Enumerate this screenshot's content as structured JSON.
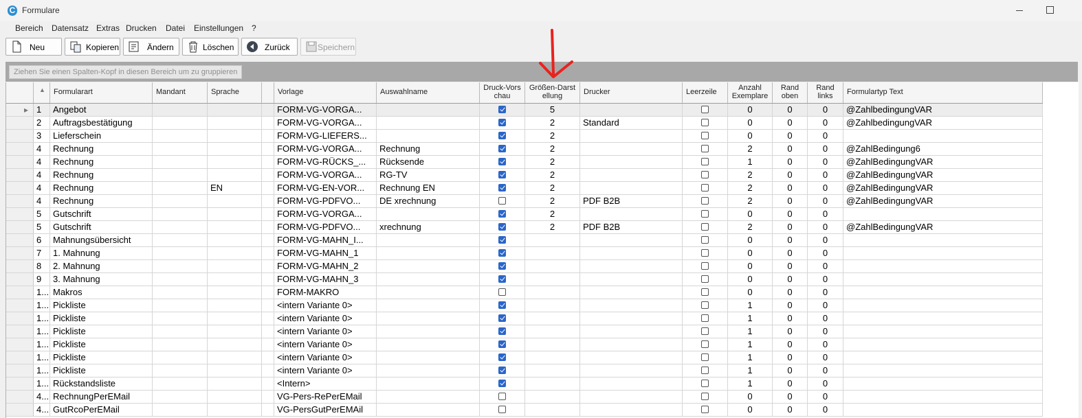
{
  "window": {
    "title": "Formulare"
  },
  "menu": [
    "Bereich",
    "Datensatz",
    "Extras",
    "Drucken",
    "Datei",
    "Einstellungen",
    "?"
  ],
  "toolbar": {
    "new_label": "Neu",
    "copy_label": "Kopieren",
    "edit_label": "Ändern",
    "delete_label": "Löschen",
    "back_label": "Zurück",
    "save_label": "Speichern"
  },
  "group_hint": "Ziehen Sie einen Spalten-Kopf in diesen Bereich um zu gruppieren",
  "columns": [
    "Formularart",
    "Mandant",
    "Sprache",
    "",
    "Vorlage",
    "Auswahlname",
    "Druck-Vorschau",
    "Größen-Darstellung",
    "Drucker",
    "Leerzeile",
    "Anzahl Exemplare",
    "Rand oben",
    "Rand links",
    "Formulartyp Text"
  ],
  "column_headers": {
    "formularart": "Formularart",
    "mandant": "Mandant",
    "sprache": "Sprache",
    "blank": "",
    "vorlage": "Vorlage",
    "auswahlname": "Auswahlname",
    "druckvorschau": "Druck-Vors chau",
    "groessen": "Größen-Darst ellung",
    "drucker": "Drucker",
    "leerzeile": "Leerzeile",
    "anzahl": "Anzahl Exemplare",
    "rand_oben": "Rand oben",
    "rand_links": "Rand links",
    "formulartyp": "Formulartyp Text"
  },
  "rows": [
    {
      "nr": "1",
      "formularart": "Angebot",
      "mandant": "",
      "sprache": "",
      "vorlage": "FORM-VG-VORGA...",
      "auswahlname": "",
      "druckvorschau": true,
      "groessen": "5",
      "drucker": "",
      "leerzeile": false,
      "anzahl": "0",
      "rand_oben": "0",
      "rand_links": "0",
      "formulartyp": "@ZahlbedingungVAR"
    },
    {
      "nr": "2",
      "formularart": "Auftragsbestätigung",
      "mandant": "",
      "sprache": "",
      "vorlage": "FORM-VG-VORGA...",
      "auswahlname": "",
      "druckvorschau": true,
      "groessen": "2",
      "drucker": "Standard",
      "leerzeile": false,
      "anzahl": "0",
      "rand_oben": "0",
      "rand_links": "0",
      "formulartyp": "@ZahlbedingungVAR"
    },
    {
      "nr": "3",
      "formularart": "Lieferschein",
      "mandant": "",
      "sprache": "",
      "vorlage": "FORM-VG-LIEFERS...",
      "auswahlname": "",
      "druckvorschau": true,
      "groessen": "2",
      "drucker": "",
      "leerzeile": false,
      "anzahl": "0",
      "rand_oben": "0",
      "rand_links": "0",
      "formulartyp": ""
    },
    {
      "nr": "4",
      "formularart": "Rechnung",
      "mandant": "",
      "sprache": "",
      "vorlage": "FORM-VG-VORGA...",
      "auswahlname": "Rechnung",
      "druckvorschau": true,
      "groessen": "2",
      "drucker": "",
      "leerzeile": false,
      "anzahl": "2",
      "rand_oben": "0",
      "rand_links": "0",
      "formulartyp": "@ZahlBedingung6"
    },
    {
      "nr": "4",
      "formularart": "Rechnung",
      "mandant": "",
      "sprache": "",
      "vorlage": "FORM-VG-RÜCKS_...",
      "auswahlname": "Rücksende",
      "druckvorschau": true,
      "groessen": "2",
      "drucker": "",
      "leerzeile": false,
      "anzahl": "1",
      "rand_oben": "0",
      "rand_links": "0",
      "formulartyp": "@ZahlBedingungVAR"
    },
    {
      "nr": "4",
      "formularart": "Rechnung",
      "mandant": "",
      "sprache": "",
      "vorlage": "FORM-VG-VORGA...",
      "auswahlname": "RG-TV",
      "druckvorschau": true,
      "groessen": "2",
      "drucker": "",
      "leerzeile": false,
      "anzahl": "2",
      "rand_oben": "0",
      "rand_links": "0",
      "formulartyp": "@ZahlBedingungVAR"
    },
    {
      "nr": "4",
      "formularart": "Rechnung",
      "mandant": "",
      "sprache": "EN",
      "vorlage": "FORM-VG-EN-VOR...",
      "auswahlname": "Rechnung EN",
      "druckvorschau": true,
      "groessen": "2",
      "drucker": "",
      "leerzeile": false,
      "anzahl": "2",
      "rand_oben": "0",
      "rand_links": "0",
      "formulartyp": "@ZahlBedingungVAR"
    },
    {
      "nr": "4",
      "formularart": "Rechnung",
      "mandant": "",
      "sprache": "",
      "vorlage": "FORM-VG-PDFVO...",
      "auswahlname": "DE xrechnung",
      "druckvorschau": false,
      "groessen": "2",
      "drucker": "PDF B2B",
      "leerzeile": false,
      "anzahl": "2",
      "rand_oben": "0",
      "rand_links": "0",
      "formulartyp": "@ZahlBedingungVAR"
    },
    {
      "nr": "5",
      "formularart": "Gutschrift",
      "mandant": "",
      "sprache": "",
      "vorlage": "FORM-VG-VORGA...",
      "auswahlname": "",
      "druckvorschau": true,
      "groessen": "2",
      "drucker": "",
      "leerzeile": false,
      "anzahl": "0",
      "rand_oben": "0",
      "rand_links": "0",
      "formulartyp": ""
    },
    {
      "nr": "5",
      "formularart": "Gutschrift",
      "mandant": "",
      "sprache": "",
      "vorlage": "FORM-VG-PDFVO...",
      "auswahlname": "xrechnung",
      "druckvorschau": true,
      "groessen": "2",
      "drucker": "PDF B2B",
      "leerzeile": false,
      "anzahl": "2",
      "rand_oben": "0",
      "rand_links": "0",
      "formulartyp": "@ZahlBedingungVAR"
    },
    {
      "nr": "6",
      "formularart": "Mahnungsübersicht",
      "mandant": "",
      "sprache": "",
      "vorlage": "FORM-VG-MAHN_I...",
      "auswahlname": "",
      "druckvorschau": true,
      "groessen": "",
      "drucker": "",
      "leerzeile": false,
      "anzahl": "0",
      "rand_oben": "0",
      "rand_links": "0",
      "formulartyp": ""
    },
    {
      "nr": "7",
      "formularart": "1. Mahnung",
      "mandant": "",
      "sprache": "",
      "vorlage": "FORM-VG-MAHN_1",
      "auswahlname": "",
      "druckvorschau": true,
      "groessen": "",
      "drucker": "",
      "leerzeile": false,
      "anzahl": "0",
      "rand_oben": "0",
      "rand_links": "0",
      "formulartyp": ""
    },
    {
      "nr": "8",
      "formularart": "2. Mahnung",
      "mandant": "",
      "sprache": "",
      "vorlage": "FORM-VG-MAHN_2",
      "auswahlname": "",
      "druckvorschau": true,
      "groessen": "",
      "drucker": "",
      "leerzeile": false,
      "anzahl": "0",
      "rand_oben": "0",
      "rand_links": "0",
      "formulartyp": ""
    },
    {
      "nr": "9",
      "formularart": "3. Mahnung",
      "mandant": "",
      "sprache": "",
      "vorlage": "FORM-VG-MAHN_3",
      "auswahlname": "",
      "druckvorschau": true,
      "groessen": "",
      "drucker": "",
      "leerzeile": false,
      "anzahl": "0",
      "rand_oben": "0",
      "rand_links": "0",
      "formulartyp": ""
    },
    {
      "nr": "1...",
      "formularart": "Makros",
      "mandant": "",
      "sprache": "",
      "vorlage": "FORM-MAKRO",
      "auswahlname": "",
      "druckvorschau": false,
      "groessen": "",
      "drucker": "",
      "leerzeile": false,
      "anzahl": "0",
      "rand_oben": "0",
      "rand_links": "0",
      "formulartyp": ""
    },
    {
      "nr": "1...",
      "formularart": "Pickliste",
      "mandant": "",
      "sprache": "",
      "vorlage": "<intern Variante 0>",
      "auswahlname": "",
      "druckvorschau": true,
      "groessen": "",
      "drucker": "",
      "leerzeile": false,
      "anzahl": "1",
      "rand_oben": "0",
      "rand_links": "0",
      "formulartyp": ""
    },
    {
      "nr": "1...",
      "formularart": "Pickliste",
      "mandant": "",
      "sprache": "",
      "vorlage": "<intern Variante 0>",
      "auswahlname": "",
      "druckvorschau": true,
      "groessen": "",
      "drucker": "",
      "leerzeile": false,
      "anzahl": "1",
      "rand_oben": "0",
      "rand_links": "0",
      "formulartyp": ""
    },
    {
      "nr": "1...",
      "formularart": "Pickliste",
      "mandant": "",
      "sprache": "",
      "vorlage": "<intern Variante 0>",
      "auswahlname": "",
      "druckvorschau": true,
      "groessen": "",
      "drucker": "",
      "leerzeile": false,
      "anzahl": "1",
      "rand_oben": "0",
      "rand_links": "0",
      "formulartyp": ""
    },
    {
      "nr": "1...",
      "formularart": "Pickliste",
      "mandant": "",
      "sprache": "",
      "vorlage": "<intern Variante 0>",
      "auswahlname": "",
      "druckvorschau": true,
      "groessen": "",
      "drucker": "",
      "leerzeile": false,
      "anzahl": "1",
      "rand_oben": "0",
      "rand_links": "0",
      "formulartyp": ""
    },
    {
      "nr": "1...",
      "formularart": "Pickliste",
      "mandant": "",
      "sprache": "",
      "vorlage": "<intern Variante 0>",
      "auswahlname": "",
      "druckvorschau": true,
      "groessen": "",
      "drucker": "",
      "leerzeile": false,
      "anzahl": "1",
      "rand_oben": "0",
      "rand_links": "0",
      "formulartyp": ""
    },
    {
      "nr": "1...",
      "formularart": "Pickliste",
      "mandant": "",
      "sprache": "",
      "vorlage": "<intern Variante 0>",
      "auswahlname": "",
      "druckvorschau": true,
      "groessen": "",
      "drucker": "",
      "leerzeile": false,
      "anzahl": "1",
      "rand_oben": "0",
      "rand_links": "0",
      "formulartyp": ""
    },
    {
      "nr": "1...",
      "formularart": "Rückstandsliste",
      "mandant": "",
      "sprache": "",
      "vorlage": "<Intern>",
      "auswahlname": "",
      "druckvorschau": true,
      "groessen": "",
      "drucker": "",
      "leerzeile": false,
      "anzahl": "1",
      "rand_oben": "0",
      "rand_links": "0",
      "formulartyp": ""
    },
    {
      "nr": "4...",
      "formularart": "RechnungPerEMail",
      "mandant": "",
      "sprache": "",
      "vorlage": "VG-Pers-RePerEMail",
      "auswahlname": "",
      "druckvorschau": false,
      "groessen": "",
      "drucker": "",
      "leerzeile": false,
      "anzahl": "0",
      "rand_oben": "0",
      "rand_links": "0",
      "formulartyp": ""
    },
    {
      "nr": "4...",
      "formularart": "GutRcoPerEMail",
      "mandant": "",
      "sprache": "",
      "vorlage": "VG-PersGutPerEMAil",
      "auswahlname": "",
      "druckvorschau": false,
      "groessen": "",
      "drucker": "",
      "leerzeile": false,
      "anzahl": "0",
      "rand_oben": "0",
      "rand_links": "0",
      "formulartyp": ""
    }
  ],
  "colors": {
    "accent": "#2a66c9",
    "annotation_arrow": "#e8231f",
    "group_panel": "#a8a8a8"
  }
}
